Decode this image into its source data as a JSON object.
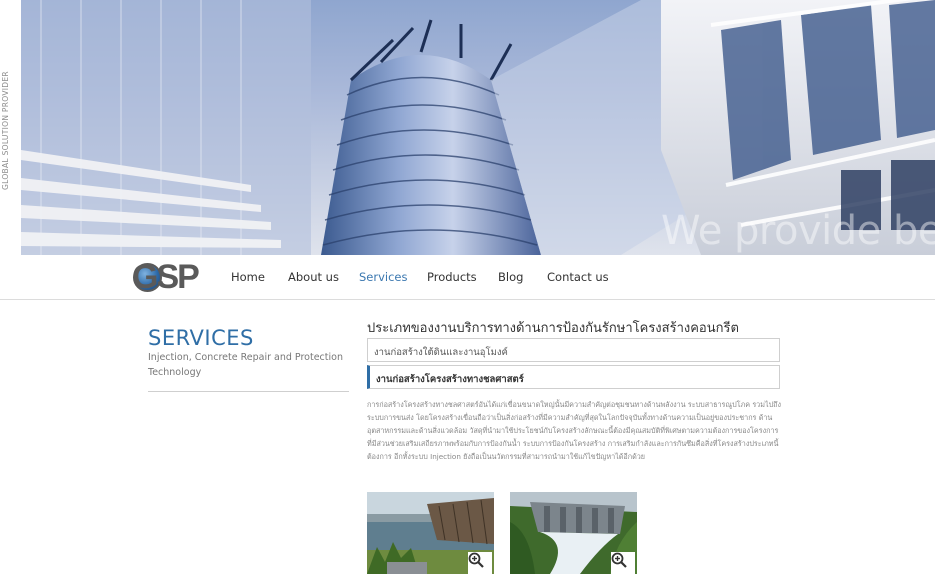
{
  "side_tagline": "GLOBAL SOLUTION PROVIDER",
  "hero": {
    "caption": "We provide bes"
  },
  "logo": {
    "text": "GSP"
  },
  "nav": {
    "items": [
      {
        "label": "Home",
        "active": false
      },
      {
        "label": "About us",
        "active": false
      },
      {
        "label": "Services",
        "active": true
      },
      {
        "label": "Products",
        "active": false
      },
      {
        "label": "Blog",
        "active": false
      },
      {
        "label": "Contact us",
        "active": false
      }
    ]
  },
  "sidebar": {
    "title": "SERVICES",
    "subtitle": "Injection, Concrete Repair and Protection Technology"
  },
  "main": {
    "title": "ประเภทของงานบริการทางด้านการป้องกันรักษาโครงสร้างคอนกรีต",
    "tabs": [
      {
        "label": "งานก่อสร้างใต้ดินและงานอุโมงค์"
      },
      {
        "label": "งานก่อสร้างโครงสร้างทางชลศาสตร์"
      }
    ],
    "body": "การก่อสร้างโครงสร้างทางชลศาสตร์อันได้แก่เขื่อนขนาดใหญ่นั้นมีความสำคัญต่อชุมชนทางด้านพลังงาน ระบบสาธารณูปโภค รวมไปถึงระบบการขนส่ง โดยโครงสร้างเขื่อนถือว่าเป็นสิ่งก่อสร้างที่มีความสำคัญที่สุดในโลกปัจจุบันทั้งทางด้านความเป็นอยู่ของประชากร ด้านอุตสาหกรรมและด้านสิ่งแวดล้อม วัสดุที่นำมาใช้ประโยชน์กับโครงสร้างลักษณะนี้ต้องมีคุณสมบัติที่พิเศษตามความต้องการของโครงการที่มีส่วนช่วยเสริมเสถียรภาพพร้อมกับการป้องกันน้ำ ระบบการป้องกันโครงสร้าง การเสริมกำลังและการกันซึมคือสิ่งที่โครงสร้างประเภทนี้ต้องการ อีกทั้งระบบ Injection ยังถือเป็นนวัตกรรมที่สามารถนำมาใช้แก้ไขปัญหาได้อีกด้วย"
  },
  "colors": {
    "accent": "#2f6ea6",
    "nav_active": "#3b78b0"
  },
  "icons": {
    "thumb_zoom": "magnifier-plus-icon"
  }
}
